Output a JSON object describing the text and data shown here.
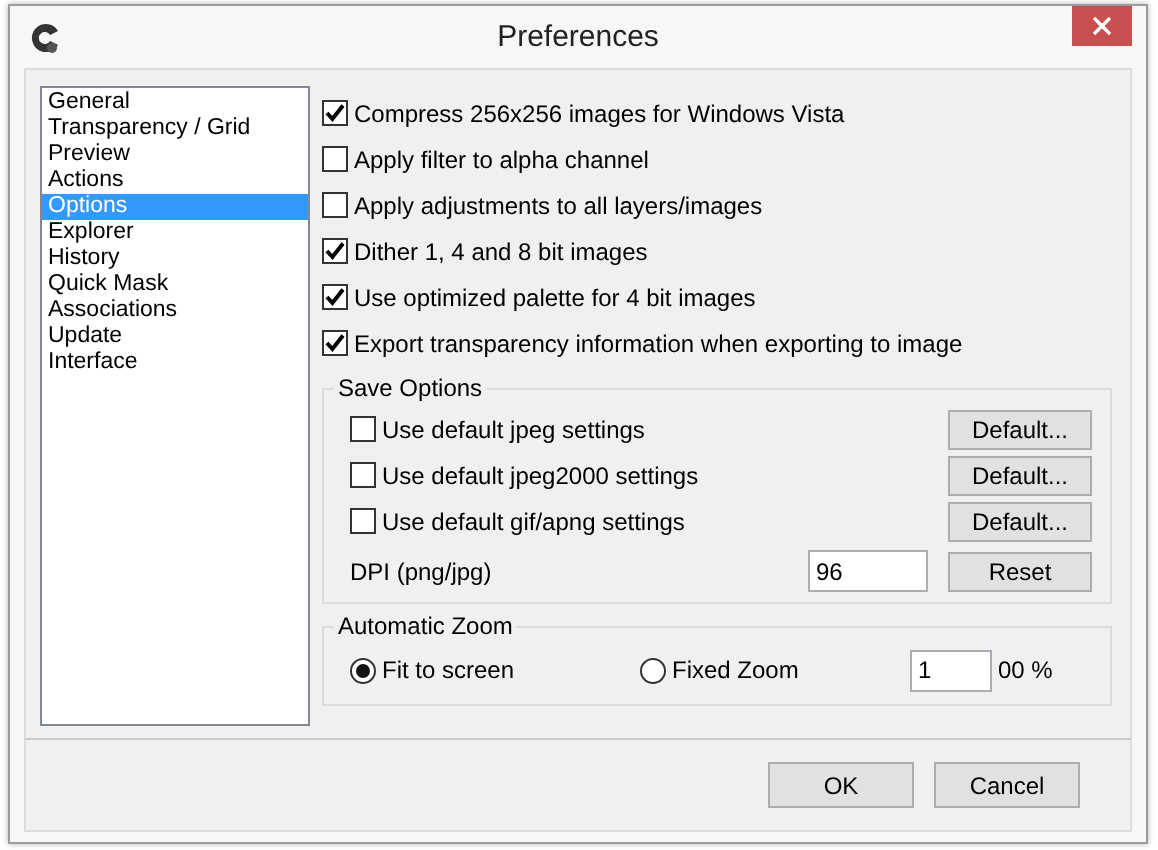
{
  "window": {
    "title": "Preferences"
  },
  "sidebar": {
    "items": [
      {
        "label": "General",
        "selected": false
      },
      {
        "label": "Transparency / Grid",
        "selected": false
      },
      {
        "label": "Preview",
        "selected": false
      },
      {
        "label": "Actions",
        "selected": false
      },
      {
        "label": "Options",
        "selected": true
      },
      {
        "label": "Explorer",
        "selected": false
      },
      {
        "label": "History",
        "selected": false
      },
      {
        "label": "Quick Mask",
        "selected": false
      },
      {
        "label": "Associations",
        "selected": false
      },
      {
        "label": "Update",
        "selected": false
      },
      {
        "label": "Interface",
        "selected": false
      }
    ]
  },
  "options": [
    {
      "label": "Compress 256x256 images for Windows Vista",
      "checked": true
    },
    {
      "label": "Apply filter to alpha channel",
      "checked": false
    },
    {
      "label": "Apply adjustments to all layers/images",
      "checked": false
    },
    {
      "label": "Dither 1, 4 and 8 bit images",
      "checked": true
    },
    {
      "label": "Use optimized palette for 4 bit images",
      "checked": true
    },
    {
      "label": "Export transparency information when exporting to image",
      "checked": true
    }
  ],
  "save_options": {
    "title": "Save Options",
    "rows": [
      {
        "label": "Use default jpeg settings",
        "checked": false,
        "button": "Default..."
      },
      {
        "label": "Use default jpeg2000 settings",
        "checked": false,
        "button": "Default..."
      },
      {
        "label": "Use default gif/apng settings",
        "checked": false,
        "button": "Default..."
      }
    ],
    "dpi": {
      "label": "DPI (png/jpg)",
      "value": "96",
      "button": "Reset"
    }
  },
  "automatic_zoom": {
    "title": "Automatic Zoom",
    "radios": [
      {
        "label": "Fit to screen",
        "selected": true
      },
      {
        "label": "Fixed Zoom",
        "selected": false
      }
    ],
    "zoom_value": "1",
    "unit": "00 %"
  },
  "buttons": [
    "OK",
    "Cancel"
  ]
}
